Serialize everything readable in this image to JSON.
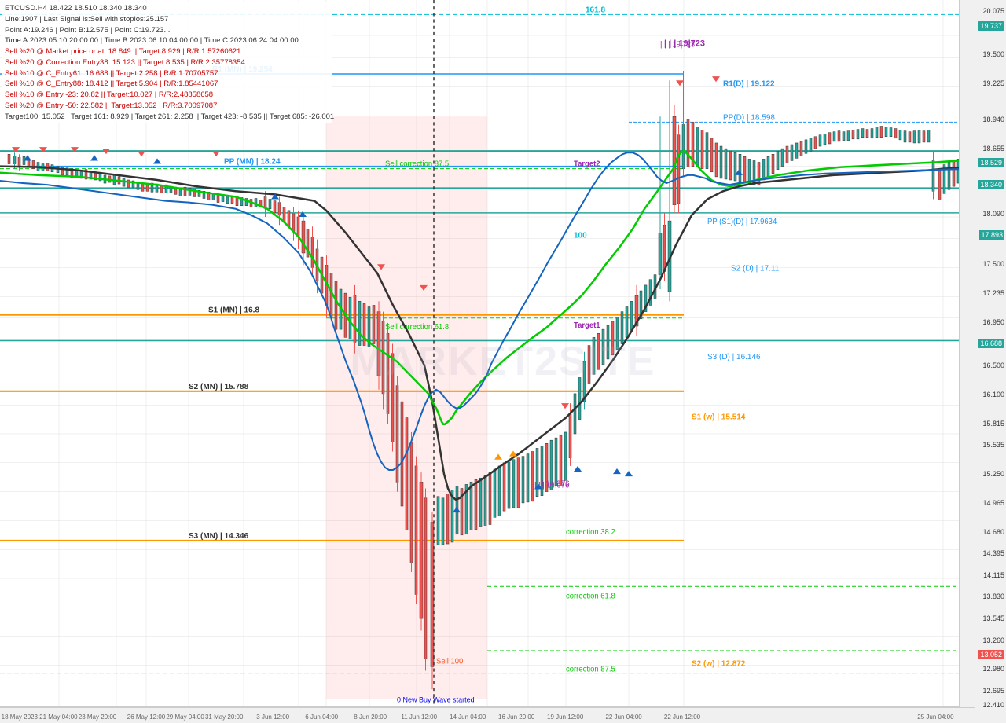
{
  "chart": {
    "symbol": "ETCUSD.H4",
    "ohlc": "18.422  18.510  18.340  18.340",
    "title": "ETCUSD.H4  18.422  18.510  18.340  18.340"
  },
  "info_panel": {
    "line1": "Line:1907 | Last Signal is:Sell with stoplos:25.157",
    "line2": "Point A:19.246 | Point B:12.575 | Point C:19.723...",
    "line3": "Time A:2023.05.10 20:00:00 | Time B:2023.06.10 04:00:00 | Time C:2023.06.24 04:00:00",
    "line4": "Sell %20 @ Market price or at: 18.849 || Target:8.929 | R/R:1.57260621",
    "line5": "Sell %20 @ Correction Entry38: 15.123 || Target:8.535 | R/R:2.35778354",
    "line6": "Sell %10 @ C_Entry61: 16.688 || Target:2.258 | R/R:1.70705757",
    "line7": "Sell %10 @ C_Entry88: 18.412 || Target:5.904 | R/R:1.85441067",
    "line8": "Sell %10 @ Entry -23: 20.82 || Target:10.027 | R/R:2.48858658",
    "line9": "Sell %20 @ Entry -50: 22.582 || Target:13.052 | R/R:3.70097087",
    "line10": "Target100: 15.052 | Target 161: 8.929 | Target 261: 2.258 || Target 423: -8.535 || Target 685: -26.001"
  },
  "levels": {
    "r1_mn": {
      "label": "R1 (MN) | 19.254",
      "value": 19.254,
      "color": "#2196F3"
    },
    "r1_d": {
      "label": "R1(D) | 19.122",
      "value": 19.122,
      "color": "#2196F3"
    },
    "pp_mn": {
      "label": "PP (MN) | 18.247",
      "value": 18.247,
      "color": "#2196F3"
    },
    "pp_d": {
      "label": "PP(D) | 18.598",
      "value": 18.598,
      "color": "#2196F3"
    },
    "pp_s1_d": {
      "label": "PP (S1)(D) | 17.9634",
      "value": 17.963,
      "color": "#2196F3"
    },
    "s1_mn": {
      "label": "S1 (MN) | 16.8",
      "value": 16.8,
      "color": "#FF9800"
    },
    "s2_d": {
      "label": "S2 (D) | 17.11",
      "value": 17.11,
      "color": "#2196F3"
    },
    "s3_d": {
      "label": "S3 (D) | 16.146",
      "value": 16.146,
      "color": "#2196F3"
    },
    "s1_w": {
      "label": "S1 (w) | 15.514",
      "value": 15.514,
      "color": "#FF9800"
    },
    "s2_mn": {
      "label": "S2 (MN) | 15.788",
      "value": 15.788,
      "color": "#FF9800"
    },
    "s3_mn": {
      "label": "S3 (MN) | 14.346",
      "value": 14.346,
      "color": "#FF9800"
    },
    "s2_w": {
      "label": "S2 (w) | 12.872",
      "value": 12.872,
      "color": "#FF9800"
    },
    "price_19723": {
      "label": "19|723",
      "value": 19.723,
      "color": "#9C27B0"
    },
    "price_14976": {
      "label": "| | | 14.976",
      "value": 14.976,
      "color": "#9C27B0"
    },
    "fib_1618": {
      "label": "161.8",
      "value": 20.2,
      "color": "#00BCD4"
    },
    "fib_100": {
      "label": "100",
      "value": 16.9,
      "color": "#00BCD4"
    },
    "sell_corr_875": {
      "label": "Sell correction 87.5",
      "value": 18.15,
      "color": "#00CC00"
    },
    "sell_corr_618": {
      "label": "Sell correction 61.8",
      "value": 16.68,
      "color": "#00CC00"
    },
    "corr_382": {
      "label": "correction 38.2",
      "value": 14.65,
      "color": "#00CC00"
    },
    "corr_618": {
      "label": "correction 61.8",
      "value": 13.75,
      "color": "#00CC00"
    },
    "corr_875": {
      "label": "correction 87.5",
      "value": 13.0,
      "color": "#00CC00"
    },
    "sell_100": {
      "label": "Sell 100",
      "value": 12.85,
      "color": "#FF5722"
    },
    "target1": {
      "label": "Target1",
      "value": 16.4,
      "color": "#9C27B0"
    },
    "target2": {
      "label": "Target2",
      "value": 18.15,
      "color": "#9C27B0"
    },
    "new_buy_wave": {
      "label": "0 New Buy Wave started",
      "value": 14.0,
      "color": "#0000FF"
    }
  },
  "price_axis": {
    "current": "18.340",
    "current_color": "#26a69a",
    "labels": [
      {
        "price": "20.075",
        "y_pct": 2
      },
      {
        "price": "19.737",
        "y_pct": 5,
        "highlight": "green"
      },
      {
        "price": "19.500",
        "y_pct": 8
      },
      {
        "price": "19.225",
        "y_pct": 12
      },
      {
        "price": "18.940",
        "y_pct": 17
      },
      {
        "price": "18.655",
        "y_pct": 21
      },
      {
        "price": "18.529",
        "y_pct": 23,
        "highlight": "green"
      },
      {
        "price": "18.340",
        "y_pct": 26,
        "highlight": "green"
      },
      {
        "price": "18.090",
        "y_pct": 30
      },
      {
        "price": "17.893",
        "y_pct": 33,
        "highlight": "teal"
      },
      {
        "price": "17.500",
        "y_pct": 37
      },
      {
        "price": "17.235",
        "y_pct": 41
      },
      {
        "price": "16.950",
        "y_pct": 45
      },
      {
        "price": "16.688",
        "y_pct": 48,
        "highlight": "green"
      },
      {
        "price": "16.500",
        "y_pct": 51
      },
      {
        "price": "16.100",
        "y_pct": 55
      },
      {
        "price": "15.815",
        "y_pct": 59
      },
      {
        "price": "15.535",
        "y_pct": 62
      },
      {
        "price": "15.250",
        "y_pct": 66
      },
      {
        "price": "14.965",
        "y_pct": 70
      },
      {
        "price": "14.680",
        "y_pct": 74
      },
      {
        "price": "14.395",
        "y_pct": 77
      },
      {
        "price": "14.115",
        "y_pct": 80
      },
      {
        "price": "13.830",
        "y_pct": 83
      },
      {
        "price": "13.545",
        "y_pct": 86
      },
      {
        "price": "13.260",
        "y_pct": 88
      },
      {
        "price": "13.052",
        "y_pct": 90,
        "highlight": "red"
      },
      {
        "price": "12.980",
        "y_pct": 91
      },
      {
        "price": "12.695",
        "y_pct": 94
      },
      {
        "price": "12.410",
        "y_pct": 97
      }
    ]
  },
  "time_axis": {
    "labels": [
      {
        "text": "18 May 2023",
        "x_pct": 2
      },
      {
        "text": "21 May 04:00",
        "x_pct": 6
      },
      {
        "text": "23 May 20:00",
        "x_pct": 10
      },
      {
        "text": "26 May 12:00",
        "x_pct": 15
      },
      {
        "text": "29 May 04:00",
        "x_pct": 19
      },
      {
        "text": "31 May 20:00",
        "x_pct": 23
      },
      {
        "text": "3 Jun 12:00",
        "x_pct": 28
      },
      {
        "text": "6 Jun 04:00",
        "x_pct": 33
      },
      {
        "text": "8 Jun 20:00",
        "x_pct": 38
      },
      {
        "text": "11 Jun 12:00",
        "x_pct": 43
      },
      {
        "text": "14 Jun 04:00",
        "x_pct": 48
      },
      {
        "text": "16 Jun 20:00",
        "x_pct": 53
      },
      {
        "text": "19 Jun 12:00",
        "x_pct": 58
      },
      {
        "text": "22 Jun 04:00",
        "x_pct": 64
      },
      {
        "text": "22 Jun 12:00",
        "x_pct": 70
      },
      {
        "text": "25 Jun 04:00",
        "x_pct": 97
      }
    ]
  },
  "watermark": "MARKET2SITE"
}
